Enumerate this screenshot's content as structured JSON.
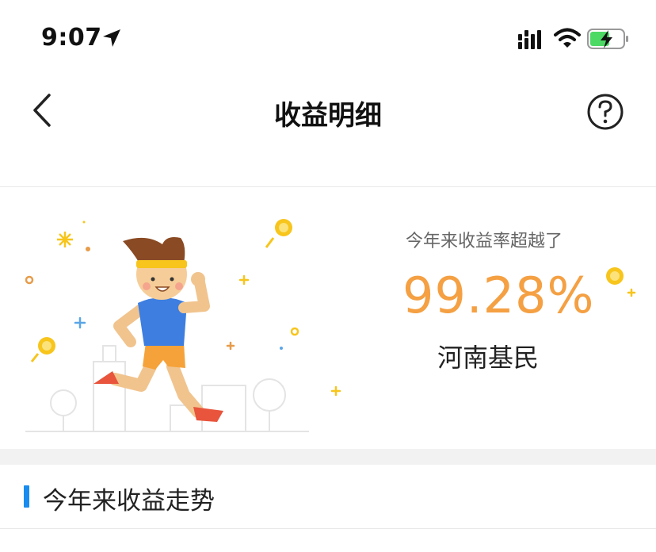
{
  "status_bar": {
    "time": "9:07",
    "icons": [
      "location-arrow-icon",
      "cellular-signal-icon",
      "wifi-icon",
      "battery-charging-icon"
    ]
  },
  "nav": {
    "title": "收益明细",
    "back_icon": "chevron-left-icon",
    "help_icon": "question-circle-icon"
  },
  "hero": {
    "caption": "今年来收益率超越了",
    "percent": "99.28%",
    "region": "河南基民",
    "illustration": "running-man-with-coins",
    "accent_color": "#f4a043"
  },
  "section": {
    "title": "今年来收益走势",
    "marker_color": "#1a8cf0"
  }
}
